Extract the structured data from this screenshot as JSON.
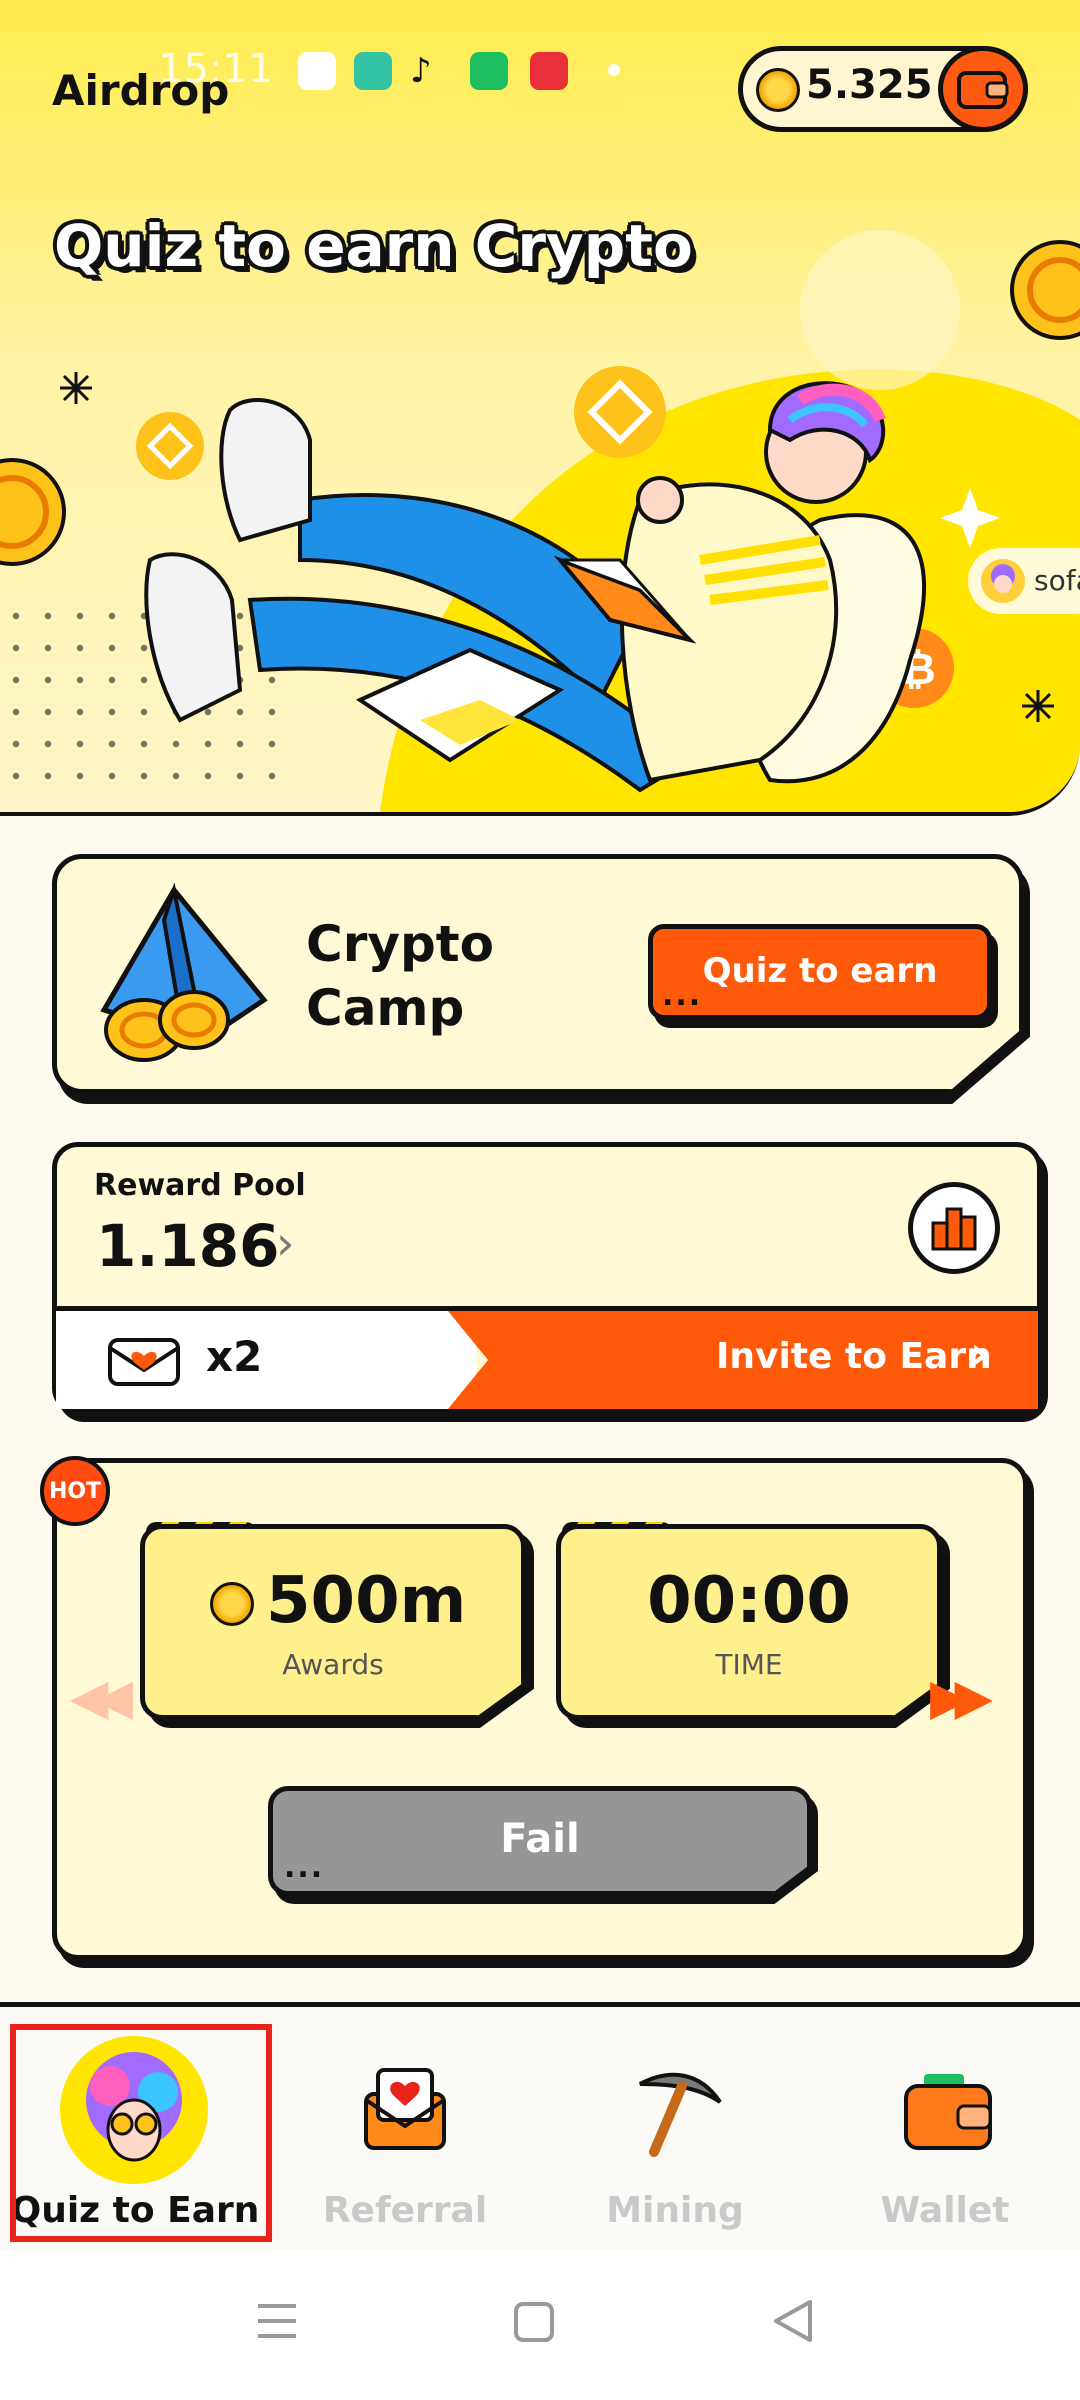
{
  "status_bar": {
    "time": "15:11"
  },
  "header": {
    "app_title": "Airdrop",
    "coin_balance": "5.325"
  },
  "hero": {
    "title": "Quiz to earn Crypto",
    "side_chip_text": "sofa"
  },
  "camp_card": {
    "title": "Crypto Camp",
    "button_label": "Quiz to earn",
    "button_dots": "..."
  },
  "reward_pool": {
    "label": "Reward Pool",
    "value": "1.186",
    "multiplier": "x2",
    "invite_label": "Invite to Earn"
  },
  "quiz_card": {
    "badge": "HOT",
    "awards_value": "500m",
    "awards_label": "Awards",
    "time_value": "00:00",
    "time_label": "TIME",
    "fail_label": "Fail",
    "fail_dots": "..."
  },
  "bottom_nav": {
    "items": [
      {
        "label": "Quiz to Earn",
        "active": true
      },
      {
        "label": "Referral",
        "active": false
      },
      {
        "label": "Mining",
        "active": false
      },
      {
        "label": "Wallet",
        "active": false
      }
    ]
  },
  "colors": {
    "accent_orange": "#ff5a0a",
    "hero_yellow": "#ffec4d",
    "card_cream": "#fff9d6",
    "inactive_label": "#c9c9c9",
    "active_highlight": "#e8241b"
  }
}
